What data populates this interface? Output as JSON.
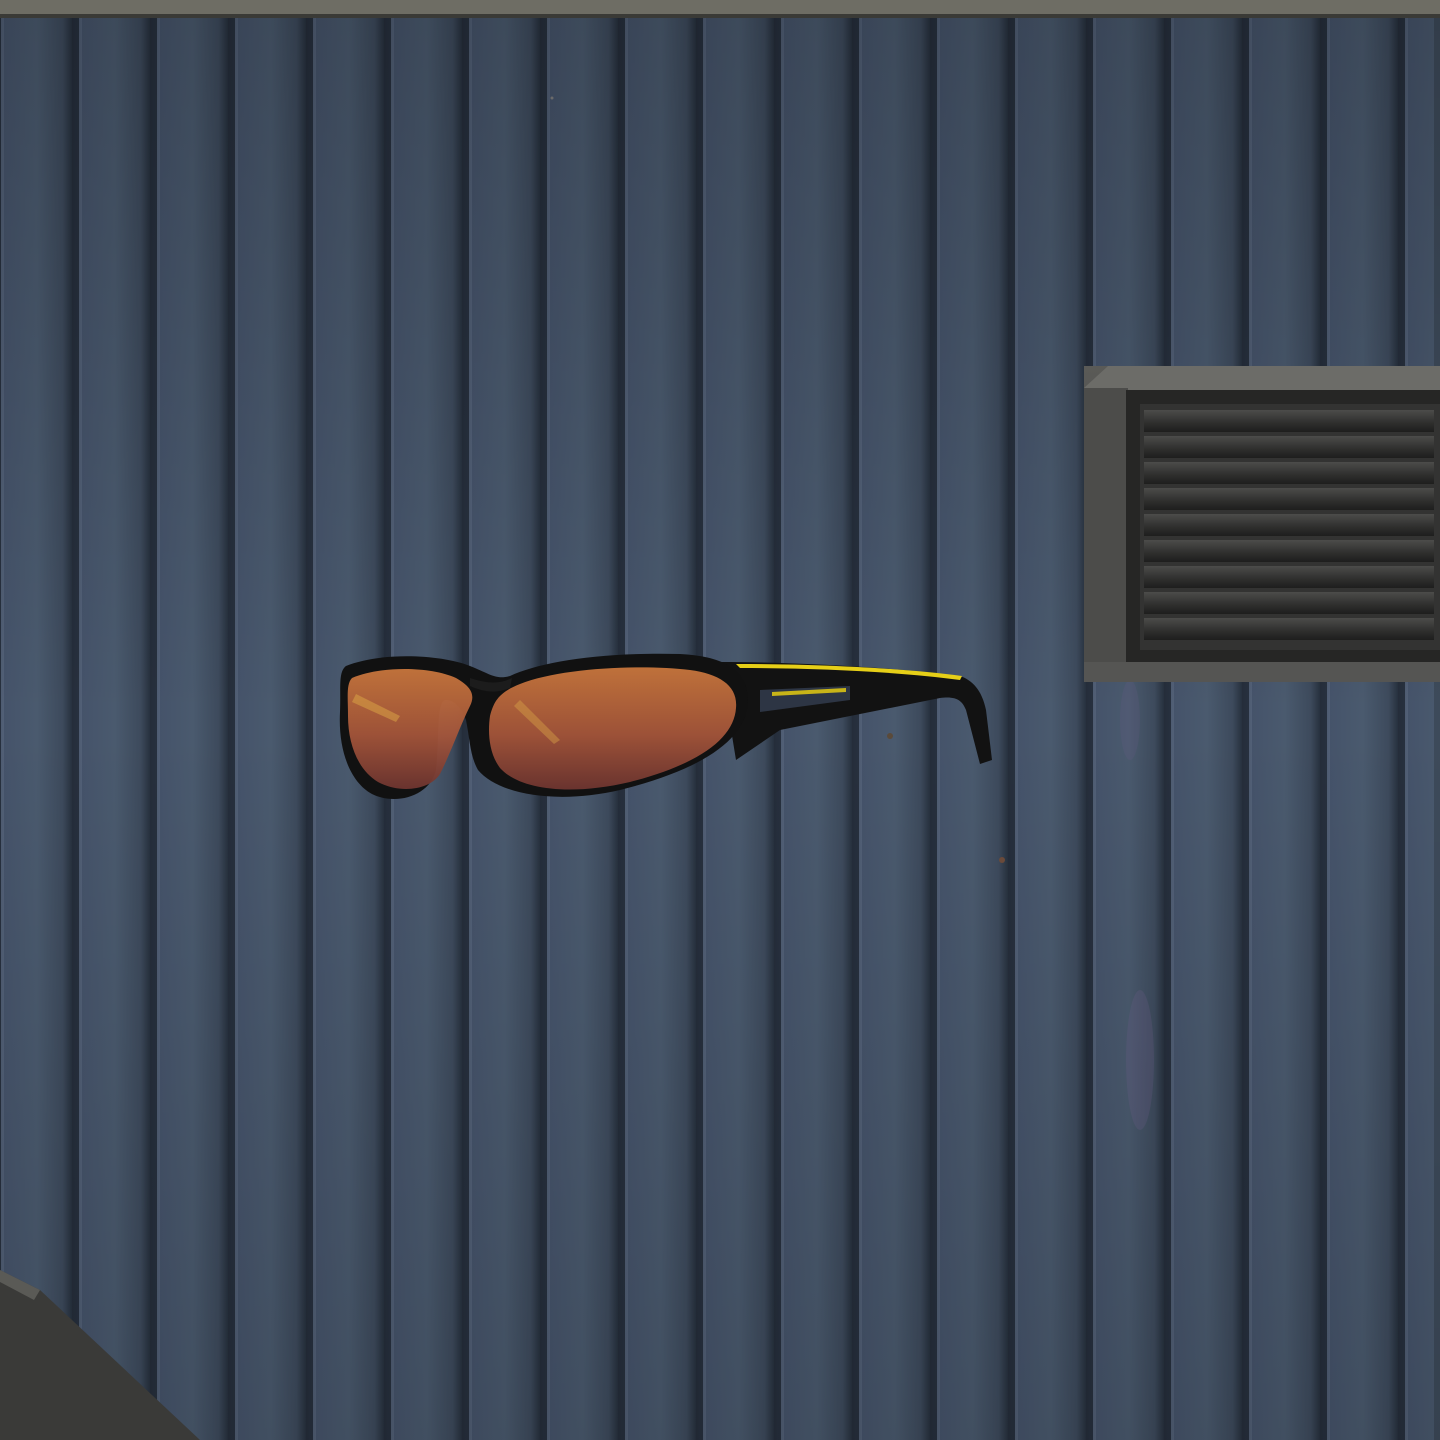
{
  "scene": {
    "item": "sunglasses",
    "colors": {
      "wall_base": "#3f4c5c",
      "wall_ridge_light": "#56657a",
      "wall_groove_dark": "#2a3442",
      "top_trim": "#6a6a62",
      "frame_black": "#111111",
      "frame_accent_yellow": "#e8d21a",
      "lens_top": "#c0703a",
      "lens_bottom": "#7a3a2a",
      "vent_body": "#4a4a48",
      "vent_slat": "#2e2e2d",
      "pipe": "#3a3a38"
    }
  }
}
